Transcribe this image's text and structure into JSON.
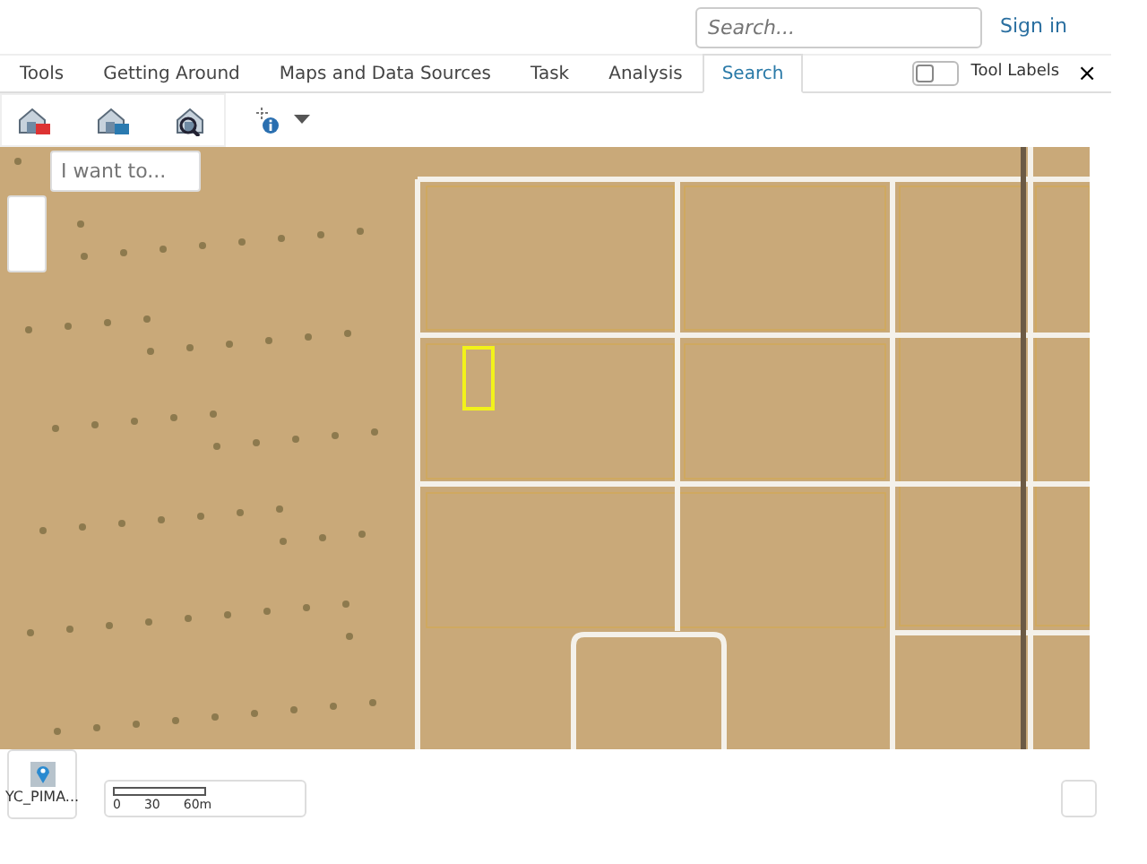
{
  "header": {
    "search": {
      "placeholder": "Search..."
    },
    "sign_in": "Sign in"
  },
  "tabs": [
    {
      "label": "Tools",
      "selected": false
    },
    {
      "label": "Getting Around",
      "selected": false
    },
    {
      "label": "Maps and Data Sources",
      "selected": false
    },
    {
      "label": "Task",
      "selected": false
    },
    {
      "label": "Analysis",
      "selected": false
    },
    {
      "label": "Search",
      "selected": true
    }
  ],
  "tool_labels": {
    "label": "Tool Labels",
    "on": false
  },
  "close": "×",
  "map": {
    "i_want_to": {
      "placeholder": "I want to..."
    },
    "basemap": {
      "label": "YC_PIMA..."
    },
    "scale_bar": {
      "labels": [
        "0",
        "30",
        "60m"
      ]
    }
  }
}
